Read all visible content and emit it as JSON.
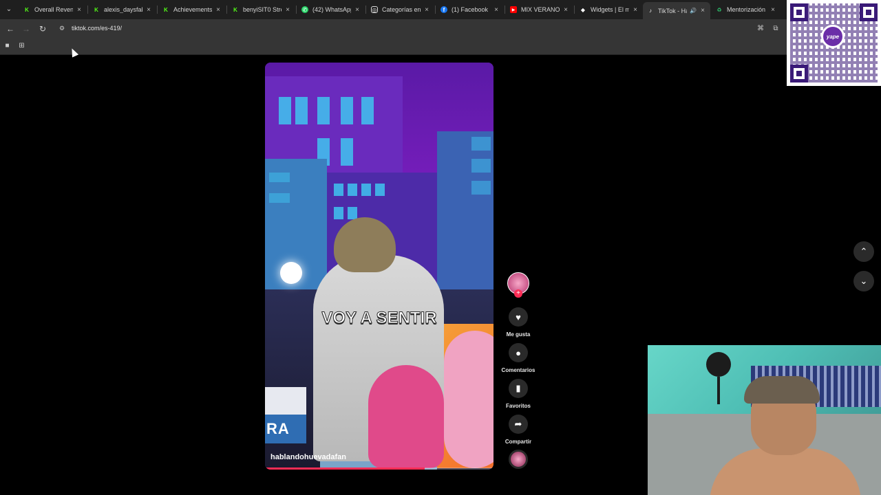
{
  "browser": {
    "tabs": [
      {
        "title": "Overall Revenu",
        "favicon": "k-icon",
        "color": "#53fc18"
      },
      {
        "title": "alexis_daysfak",
        "favicon": "k-icon",
        "color": "#53fc18"
      },
      {
        "title": "Achievements",
        "favicon": "k-icon",
        "color": "#53fc18"
      },
      {
        "title": "benyiSIT0 Stre",
        "favicon": "k-icon",
        "color": "#53fc18"
      },
      {
        "title": "(42) WhatsApp",
        "favicon": "whatsapp-icon",
        "color": "#25d366"
      },
      {
        "title": "Categorías en",
        "favicon": "instagram-icon",
        "color": "#ffffff"
      },
      {
        "title": "(1) Facebook",
        "favicon": "facebook-icon",
        "color": "#1877f2"
      },
      {
        "title": "MIX VERANO",
        "favicon": "youtube-icon",
        "color": "#ff0000"
      },
      {
        "title": "Widgets | El m",
        "favicon": "widget-icon",
        "color": "#ffffff"
      },
      {
        "title": "TikTok - Ha",
        "favicon": "tiktok-icon",
        "color": "#ffffff",
        "active": true
      },
      {
        "title": "Mentorización",
        "favicon": "recycle-icon",
        "color": "#2ecc71"
      }
    ],
    "url": "tiktok.com/es-419/"
  },
  "video": {
    "caption": "VOY A SENTIR",
    "author": "hablandohuevadafan",
    "side_card_text": "RA",
    "progress": 0.7
  },
  "actions": {
    "follow_symbol": "+",
    "like_label": "Me gusta",
    "comment_label": "Comentarios",
    "favorite_label": "Favoritos",
    "share_label": "Compartir"
  },
  "overlay": {
    "qr_brand": "yape"
  },
  "colors": {
    "accent": "#fe2c55",
    "chrome_dark": "#1f1f1f",
    "chrome_toolbar": "#353535"
  }
}
